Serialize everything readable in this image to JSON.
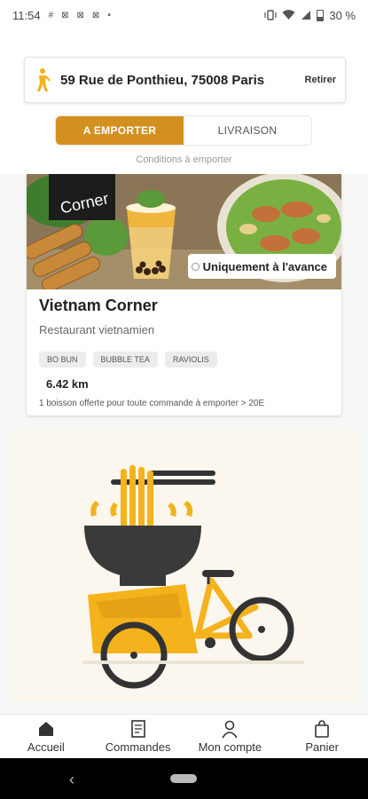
{
  "status_bar": {
    "time": "11:54",
    "notification_icons": [
      "#",
      "⊠",
      "⊠",
      "⊠",
      "•"
    ],
    "battery": "30 %"
  },
  "address": {
    "text": "59 Rue de Ponthieu, 75008 Paris",
    "action": "Retirer"
  },
  "mode_toggle": {
    "options": [
      "A EMPORTER",
      "LIVRAISON"
    ],
    "selected": "A EMPORTER",
    "accent": "#d4901f"
  },
  "conditions_link": "Conditions à emporter",
  "restaurant": {
    "photo_sign_text": "Corner",
    "badge": "Uniquement à l'avance",
    "name": "Vietnam Corner",
    "type": "Restaurant vietnamien",
    "tags": [
      "BO BUN",
      "BUBBLE TEA",
      "RAVIOLIS"
    ],
    "distance": "6.42 km",
    "offer": "1 boisson offerte pour toute commande à emporter > 20E"
  },
  "bottom_nav": [
    {
      "label": "Accueil",
      "icon": "home-icon"
    },
    {
      "label": "Commandes",
      "icon": "receipt-icon"
    },
    {
      "label": "Mon compte",
      "icon": "user-icon"
    },
    {
      "label": "Panier",
      "icon": "bag-icon"
    }
  ]
}
